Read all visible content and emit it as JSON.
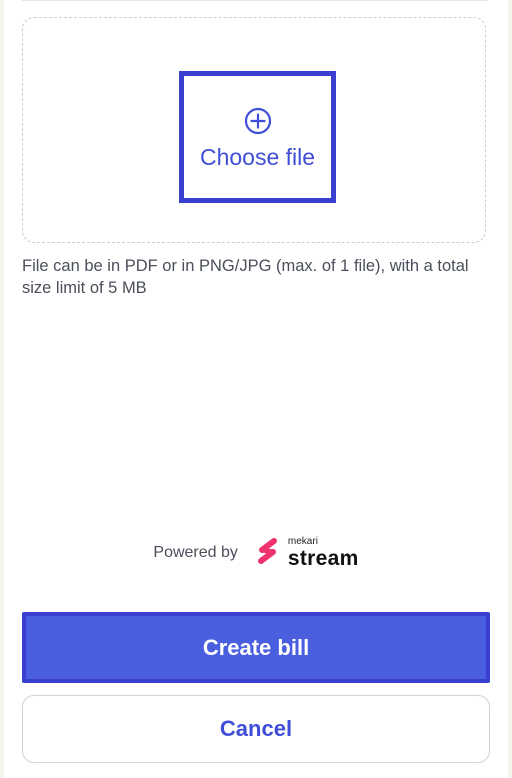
{
  "upload": {
    "choose_file_label": "Choose file",
    "plus_icon": "plus-circle-icon",
    "helper_text": "File can be in PDF or in PNG/JPG (max. of 1 file), with a total size limit of 5 MB"
  },
  "footer": {
    "powered_by": "Powered by",
    "brand_small": "mekari",
    "brand_name": "stream",
    "brand_mark_icon": "mekari-stream-logo",
    "brand_color": "#f0336c"
  },
  "actions": {
    "primary_label": "Create bill",
    "secondary_label": "Cancel"
  },
  "colors": {
    "accent": "#3f4ed6",
    "primary_button": "#4a5fe0",
    "focus_outline": "#3b3fcf"
  }
}
